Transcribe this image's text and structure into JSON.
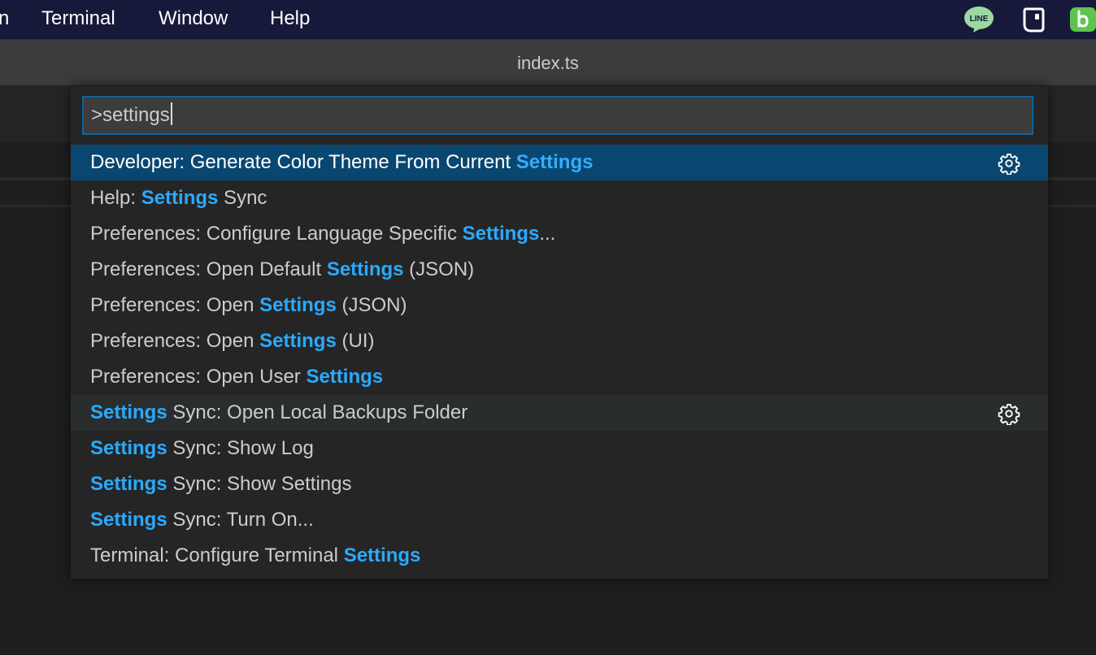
{
  "menubar": {
    "items": [
      {
        "label": "n"
      },
      {
        "label": "Terminal"
      },
      {
        "label": "Window"
      },
      {
        "label": "Help"
      }
    ],
    "tray": [
      {
        "icon": "line-app-icon",
        "label": "LINE",
        "color": "#9bd9a0"
      },
      {
        "icon": "notes-widget-icon"
      },
      {
        "icon": "green-b-app-icon",
        "color": "#5ec44d"
      }
    ]
  },
  "window": {
    "title": "index.ts"
  },
  "palette": {
    "input_value": ">settings",
    "highlight_color": "#2aaaff",
    "selected_color": "#094771",
    "items": [
      {
        "parts": [
          {
            "t": "Developer: Generate Color Theme From Current ",
            "h": false
          },
          {
            "t": "Settings",
            "h": true
          }
        ],
        "gear": true,
        "state": "selected"
      },
      {
        "parts": [
          {
            "t": "Help: ",
            "h": false
          },
          {
            "t": "Settings",
            "h": true
          },
          {
            "t": " Sync",
            "h": false
          }
        ],
        "gear": false,
        "state": ""
      },
      {
        "parts": [
          {
            "t": "Preferences: Configure Language Specific ",
            "h": false
          },
          {
            "t": "Settings",
            "h": true
          },
          {
            "t": "...",
            "h": false
          }
        ],
        "gear": false,
        "state": ""
      },
      {
        "parts": [
          {
            "t": "Preferences: Open Default ",
            "h": false
          },
          {
            "t": "Settings",
            "h": true
          },
          {
            "t": " (JSON)",
            "h": false
          }
        ],
        "gear": false,
        "state": ""
      },
      {
        "parts": [
          {
            "t": "Preferences: Open ",
            "h": false
          },
          {
            "t": "Settings",
            "h": true
          },
          {
            "t": " (JSON)",
            "h": false
          }
        ],
        "gear": false,
        "state": ""
      },
      {
        "parts": [
          {
            "t": "Preferences: Open ",
            "h": false
          },
          {
            "t": "Settings",
            "h": true
          },
          {
            "t": " (UI)",
            "h": false
          }
        ],
        "gear": false,
        "state": ""
      },
      {
        "parts": [
          {
            "t": "Preferences: Open User ",
            "h": false
          },
          {
            "t": "Settings",
            "h": true
          }
        ],
        "gear": false,
        "state": ""
      },
      {
        "parts": [
          {
            "t": "Settings",
            "h": true
          },
          {
            "t": " Sync: Open Local Backups Folder",
            "h": false
          }
        ],
        "gear": true,
        "state": "hover"
      },
      {
        "parts": [
          {
            "t": "Settings",
            "h": true
          },
          {
            "t": " Sync: Show Log",
            "h": false
          }
        ],
        "gear": false,
        "state": ""
      },
      {
        "parts": [
          {
            "t": "Settings",
            "h": true
          },
          {
            "t": " Sync: Show Settings",
            "h": false
          }
        ],
        "gear": false,
        "state": ""
      },
      {
        "parts": [
          {
            "t": "Settings",
            "h": true
          },
          {
            "t": " Sync: Turn On...",
            "h": false
          }
        ],
        "gear": false,
        "state": ""
      },
      {
        "parts": [
          {
            "t": "Terminal: Configure Terminal ",
            "h": false
          },
          {
            "t": "Settings",
            "h": true
          }
        ],
        "gear": false,
        "state": ""
      }
    ]
  }
}
